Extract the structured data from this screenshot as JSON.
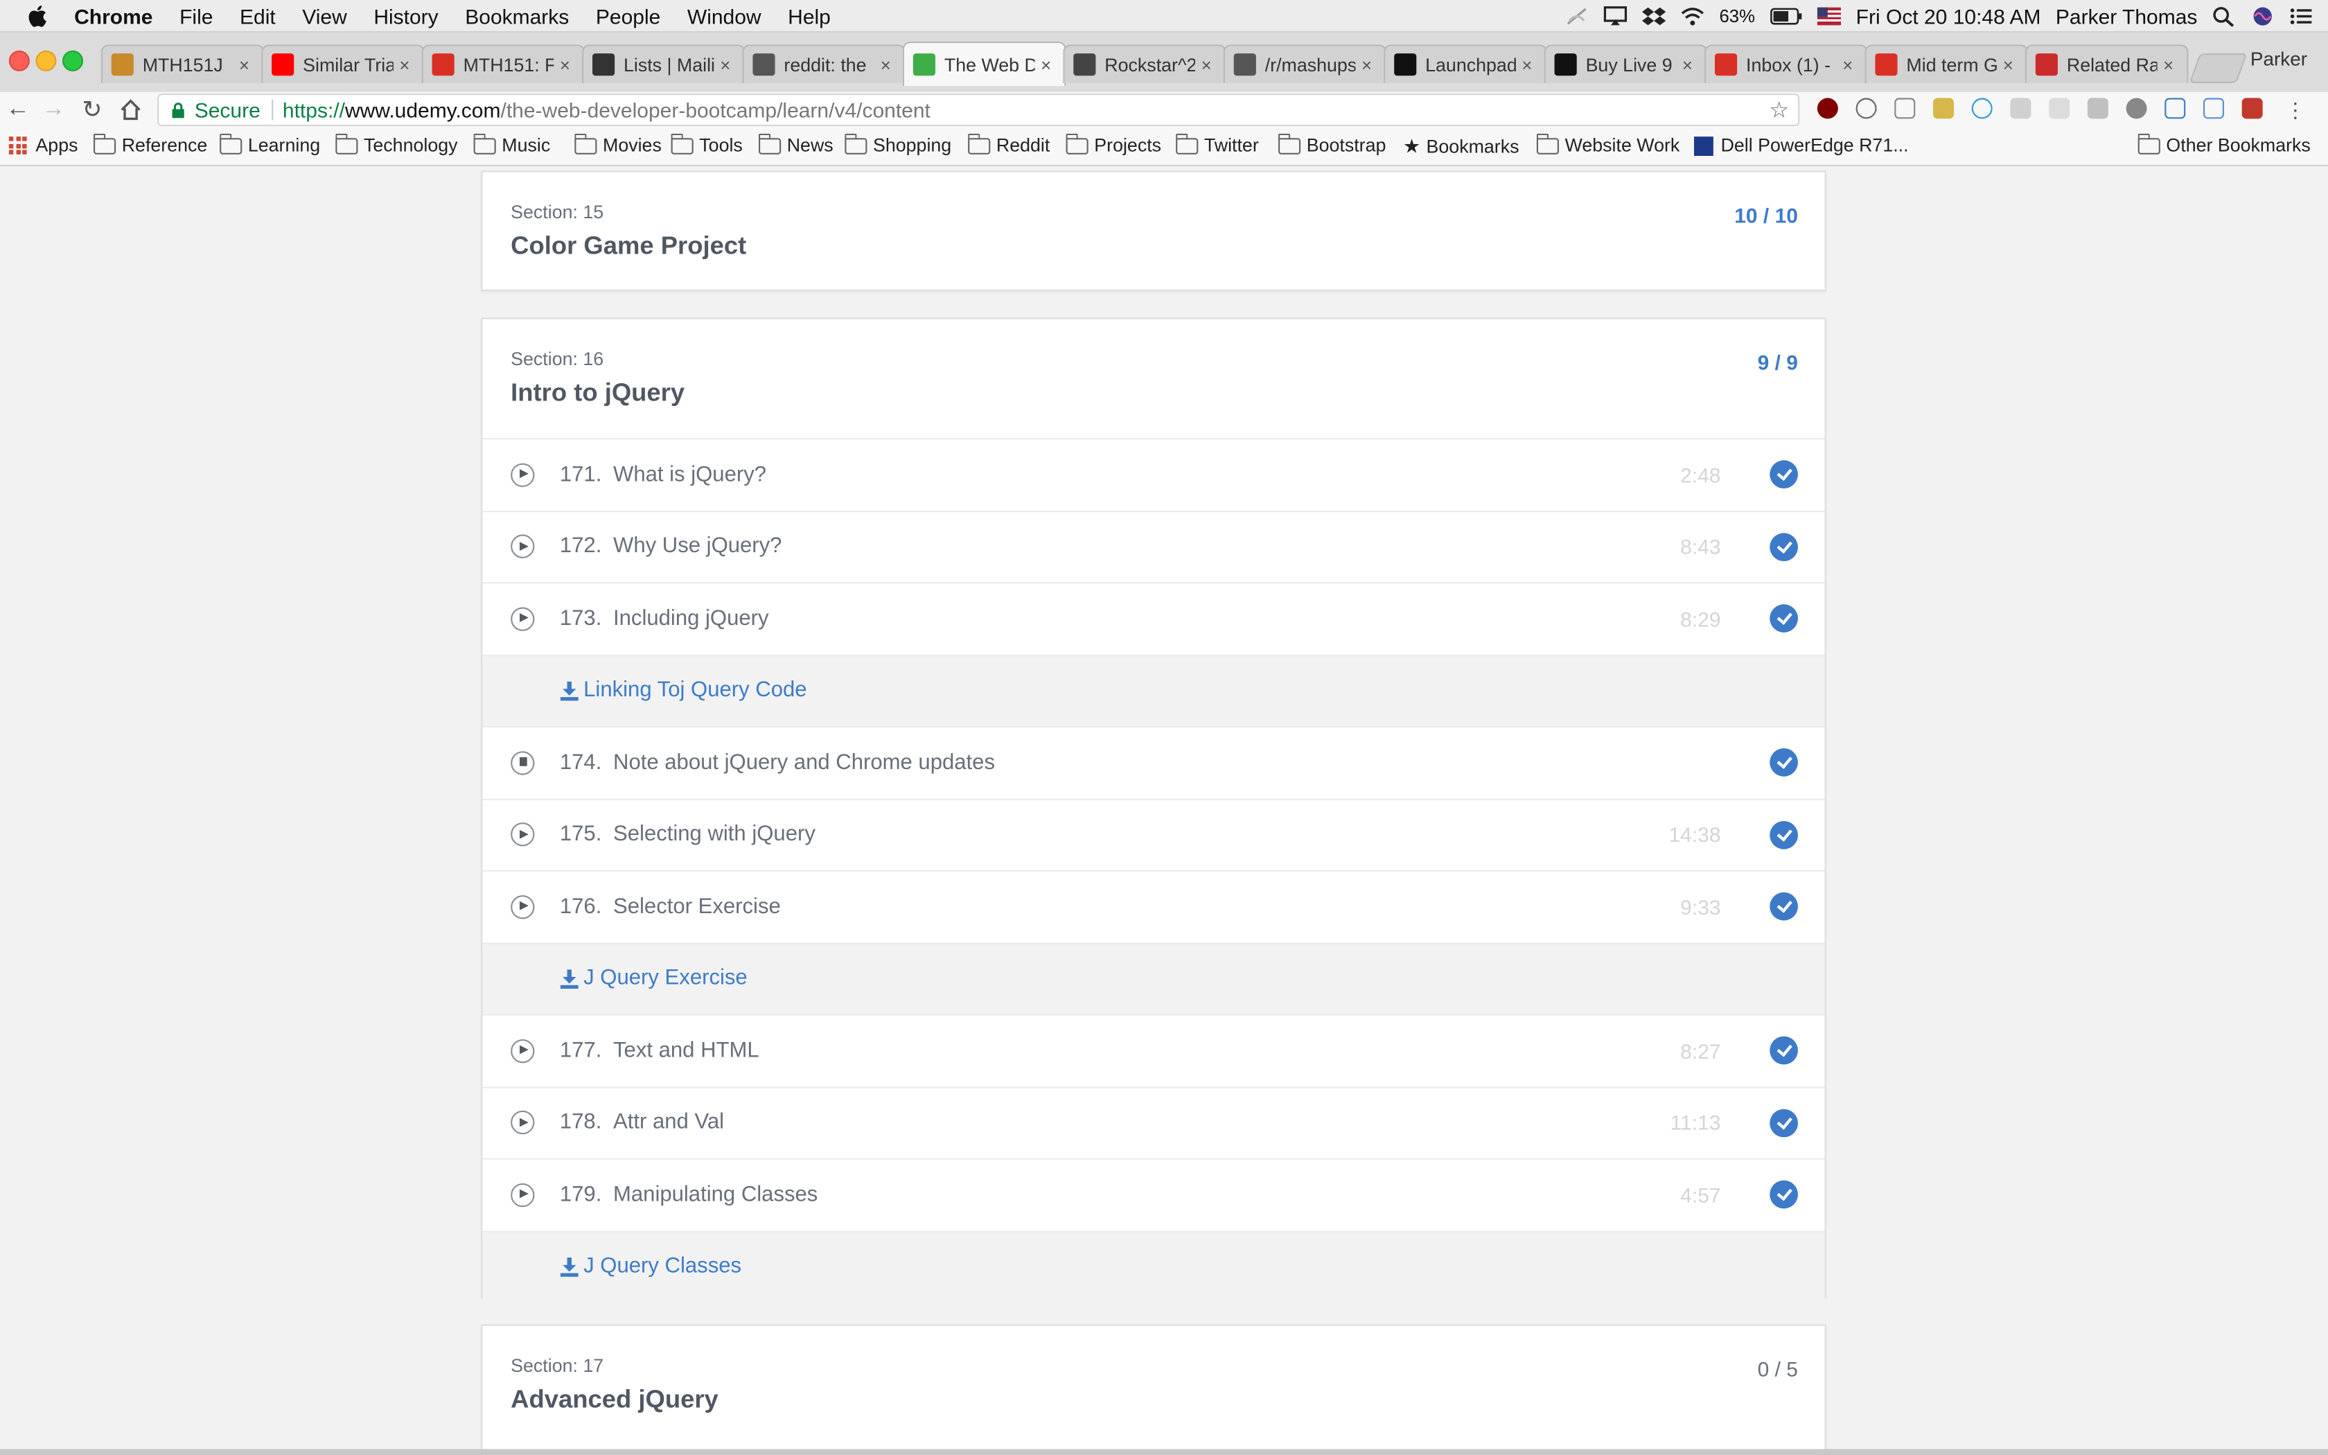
{
  "menubar": {
    "app": "Chrome",
    "menus": [
      "File",
      "Edit",
      "View",
      "History",
      "Bookmarks",
      "People",
      "Window",
      "Help"
    ],
    "battery": "63%",
    "clock": "Fri Oct 20  10:48 AM",
    "user": "Parker Thomas"
  },
  "tabs": [
    {
      "title": "MTH151J",
      "favicon": "mortarboard-icon",
      "color": "#c98a2b"
    },
    {
      "title": "Similar Tria",
      "favicon": "youtube-icon",
      "color": "#ff0000"
    },
    {
      "title": "MTH151: F",
      "favicon": "gmail-icon",
      "color": "#d93025"
    },
    {
      "title": "Lists | Maili",
      "favicon": "mailchimp-icon",
      "color": "#333333"
    },
    {
      "title": "reddit: the",
      "favicon": "reddit-icon",
      "color": "#555555"
    },
    {
      "title": "The Web D",
      "favicon": "udemy-icon",
      "color": "#3fae49",
      "active": true
    },
    {
      "title": "Rockstar^2",
      "favicon": "rockstar-icon",
      "color": "#444444"
    },
    {
      "title": "/r/mashups",
      "favicon": "reddit-icon",
      "color": "#555555"
    },
    {
      "title": "Launchpad",
      "favicon": "launchpad-icon",
      "color": "#111111"
    },
    {
      "title": "Buy Live 9",
      "favicon": "ableton-icon",
      "color": "#111111"
    },
    {
      "title": "Inbox (1) -",
      "favicon": "gmail-icon",
      "color": "#d93025"
    },
    {
      "title": "Mid term G",
      "favicon": "gmail-icon",
      "color": "#d93025"
    },
    {
      "title": "Related Ra",
      "favicon": "wolfram-icon",
      "color": "#cc2b2b"
    }
  ],
  "profile_name": "Parker",
  "omnibox": {
    "secure_label": "Secure",
    "scheme": "https://",
    "host": "www.udemy.com",
    "path": "/the-web-developer-bootcamp/learn/v4/content"
  },
  "bookmarks": {
    "apps_label": "Apps",
    "items": [
      "Reference",
      "Learning",
      "Technology",
      "Music",
      "Movies",
      "Tools",
      "News",
      "Shopping",
      "Reddit",
      "Projects",
      "Twitter",
      "Bootstrap"
    ],
    "starred": "Bookmarks",
    "website_work": "Website Work",
    "dell": "Dell PowerEdge R71...",
    "other": "Other Bookmarks"
  },
  "sections": [
    {
      "label": "Section: 15",
      "title": "Color Game Project",
      "count": "10 / 10"
    },
    {
      "label": "Section: 16",
      "title": "Intro to jQuery",
      "count": "9 / 9",
      "rows": [
        {
          "kind": "lecture",
          "icon": "play",
          "num": "171.",
          "name": "What is jQuery?",
          "dur": "2:48"
        },
        {
          "kind": "lecture",
          "icon": "play",
          "num": "172.",
          "name": "Why Use jQuery?",
          "dur": "8:43"
        },
        {
          "kind": "lecture",
          "icon": "play",
          "num": "173.",
          "name": "Including jQuery",
          "dur": "8:29"
        },
        {
          "kind": "resource",
          "name": "Linking Toj Query Code"
        },
        {
          "kind": "lecture",
          "icon": "doc",
          "num": "174.",
          "name": "Note about jQuery and Chrome updates",
          "dur": ""
        },
        {
          "kind": "lecture",
          "icon": "play",
          "num": "175.",
          "name": "Selecting with jQuery",
          "dur": "14:38"
        },
        {
          "kind": "lecture",
          "icon": "play",
          "num": "176.",
          "name": "Selector Exercise",
          "dur": "9:33"
        },
        {
          "kind": "resource",
          "name": "J Query Exercise"
        },
        {
          "kind": "lecture",
          "icon": "play",
          "num": "177.",
          "name": "Text and HTML",
          "dur": "8:27"
        },
        {
          "kind": "lecture",
          "icon": "play",
          "num": "178.",
          "name": "Attr and Val",
          "dur": "11:13"
        },
        {
          "kind": "lecture",
          "icon": "play",
          "num": "179.",
          "name": "Manipulating Classes",
          "dur": "4:57"
        },
        {
          "kind": "resource",
          "name": "J Query Classes"
        }
      ]
    },
    {
      "label": "Section: 17",
      "title": "Advanced jQuery",
      "count": "0 / 5"
    }
  ],
  "colors": {
    "accent": "#3d7bc9",
    "secure_green": "#0b8043",
    "background": "#f2f2f2"
  }
}
